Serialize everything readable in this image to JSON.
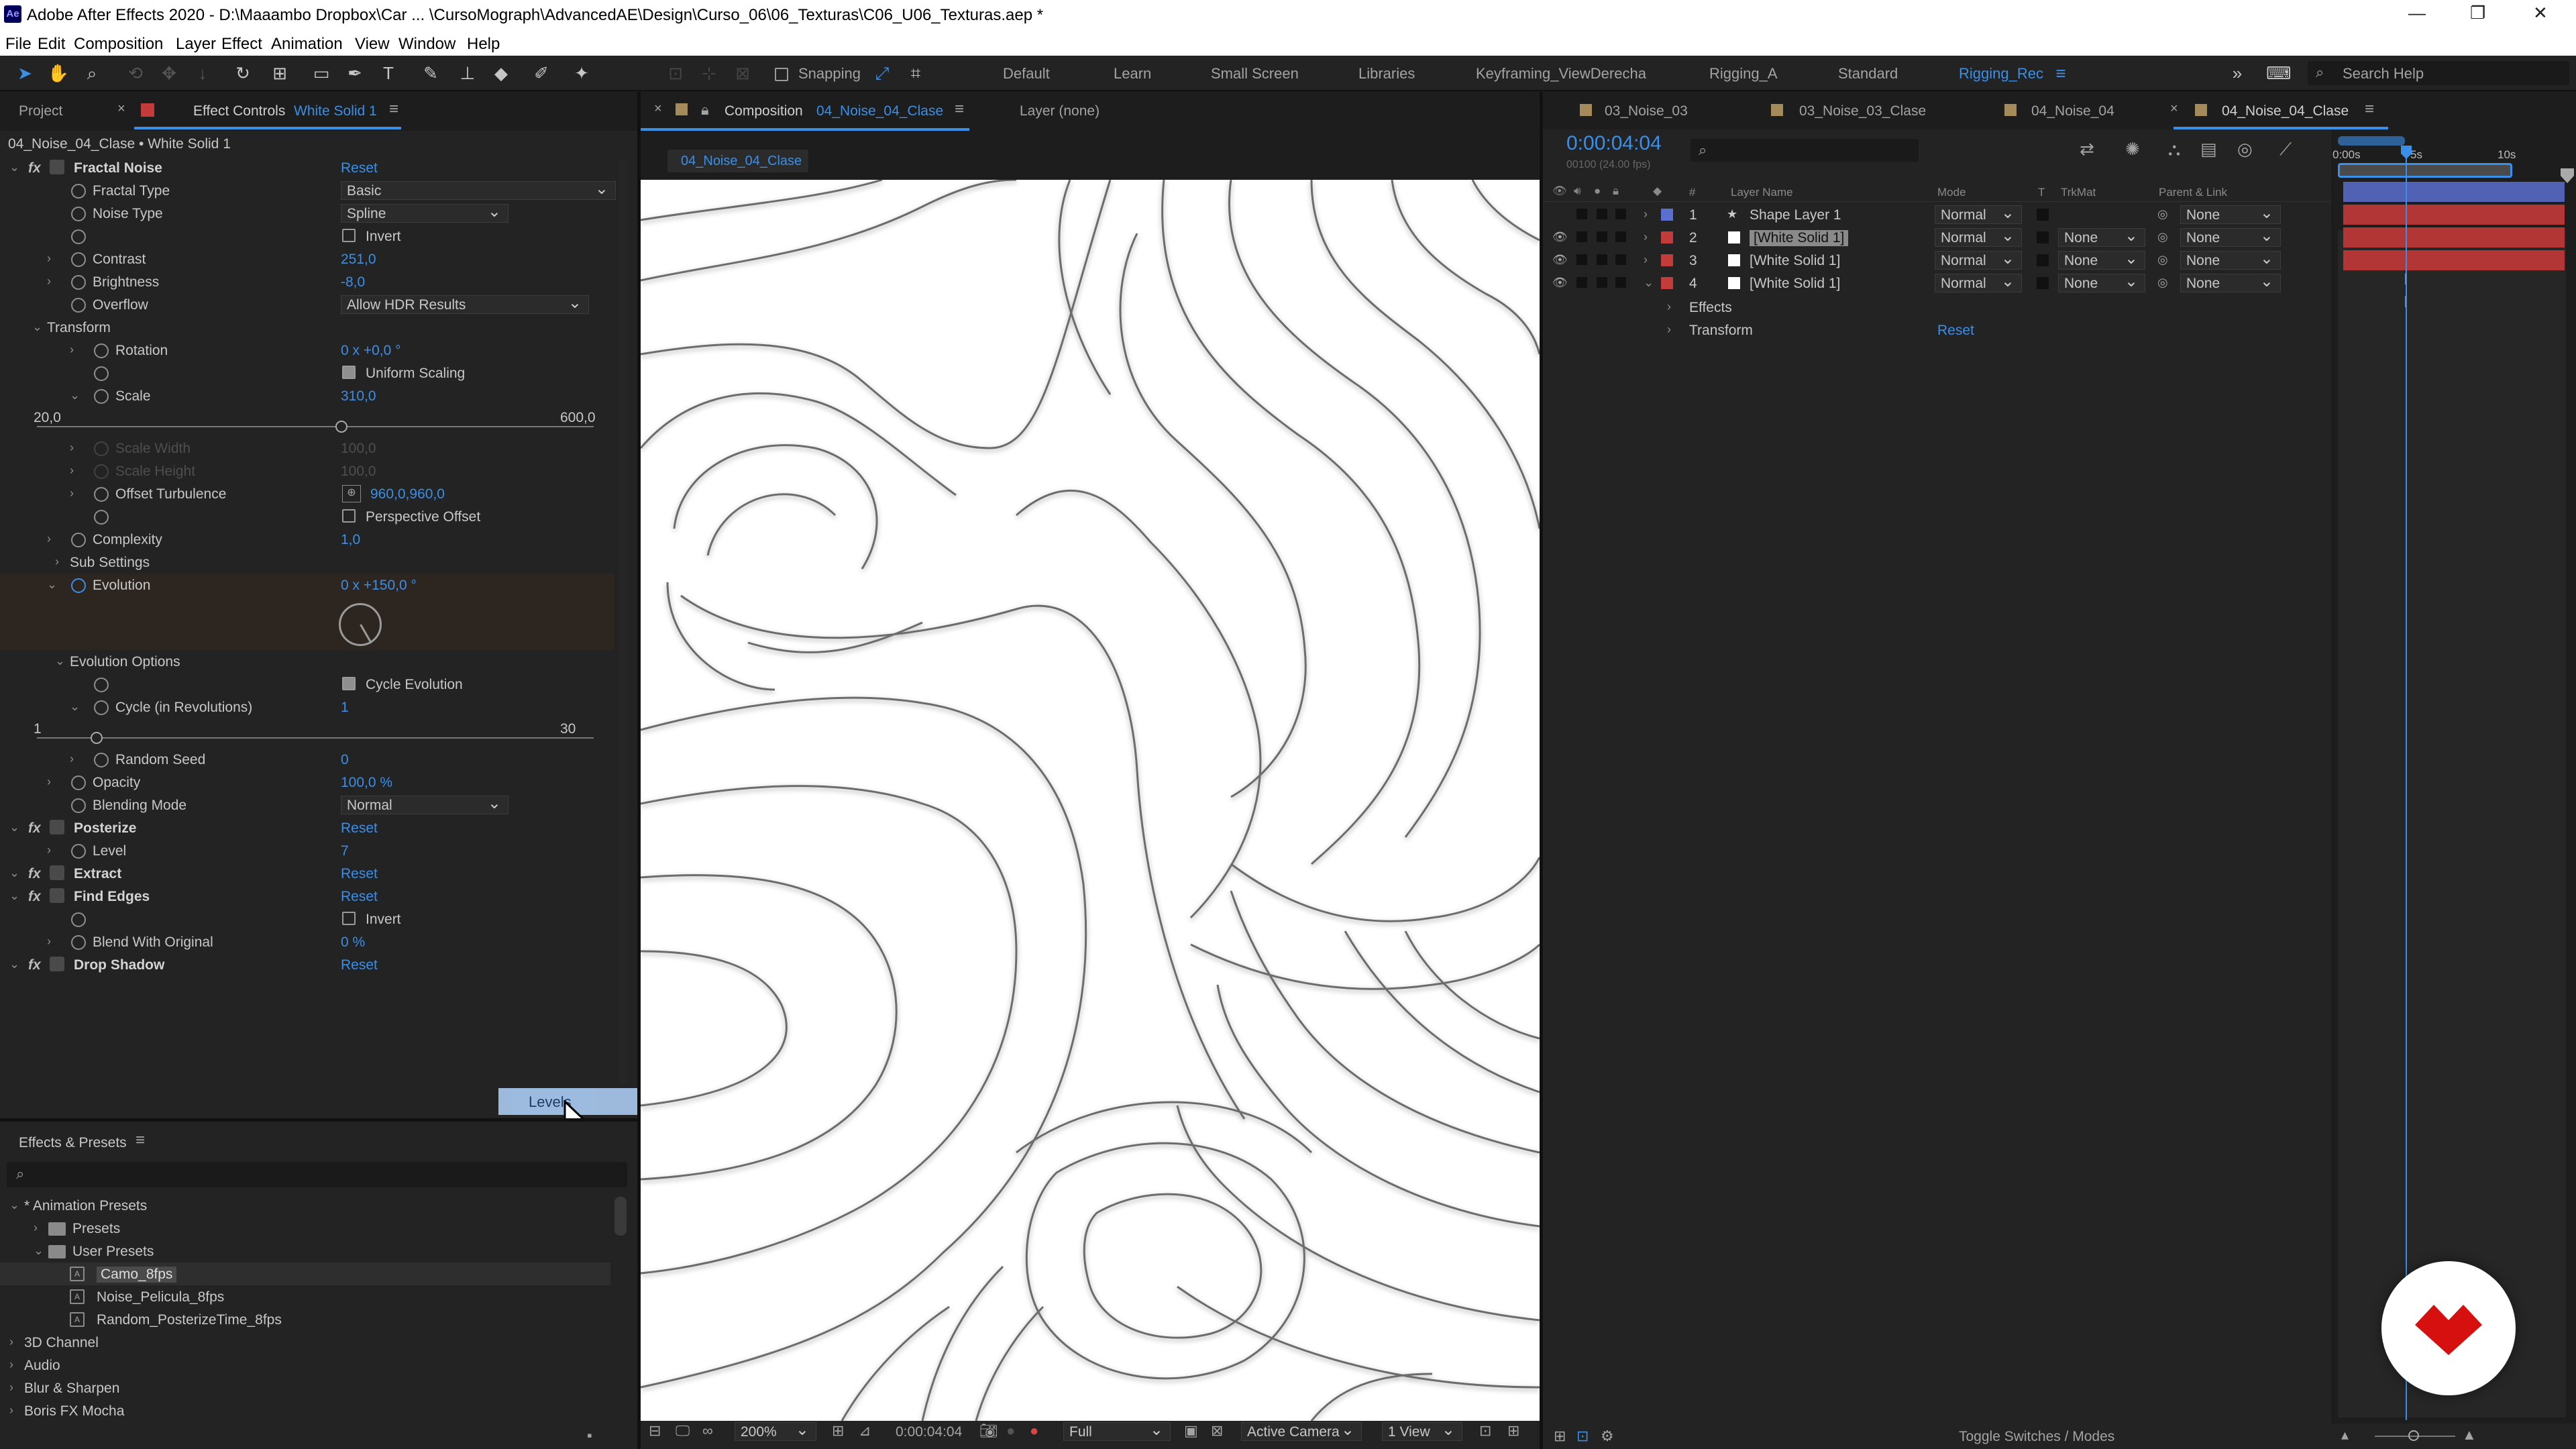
{
  "titlebar": {
    "app_icon": "Ae",
    "title": "Adobe After Effects 2020 - D:\\Maaambo Dropbox\\Car ... \\CursoMograph\\AdvancedAE\\Design\\Curso_06\\06_Texturas\\C06_U06_Texturas.aep *"
  },
  "menu": [
    "File",
    "Edit",
    "Composition",
    "Layer",
    "Effect",
    "Animation",
    "View",
    "Window",
    "Help"
  ],
  "toolbar": {
    "snapping": "Snapping",
    "workspaces": [
      "Default",
      "Learn",
      "Small Screen",
      "Libraries",
      "Keyframing_ViewDerecha",
      "Rigging_A",
      "Standard",
      "Rigging_Rec"
    ],
    "search_help": "Search Help"
  },
  "left_panel": {
    "tab_project": "Project",
    "tab_effect_controls": "Effect Controls",
    "tab_effect_target": "White Solid 1",
    "header": "04_Noise_04_Clase • White Solid 1",
    "rows": [
      {
        "label": "Fractal Noise",
        "value": "Reset",
        "kind": "fx"
      },
      {
        "label": "Fractal Type",
        "value": "Basic",
        "kind": "dropdown"
      },
      {
        "label": "Noise Type",
        "value": "Spline",
        "kind": "dropdown"
      },
      {
        "label": "",
        "value": "Invert",
        "kind": "check"
      },
      {
        "label": "Contrast",
        "value": "251,0",
        "kind": "value"
      },
      {
        "label": "Brightness",
        "value": "-8,0",
        "kind": "value"
      },
      {
        "label": "Overflow",
        "value": "Allow HDR Results",
        "kind": "dropdown"
      },
      {
        "label": "Transform",
        "value": "",
        "kind": "group"
      },
      {
        "label": "Rotation",
        "value": "0 x +0,0 °",
        "kind": "value"
      },
      {
        "label": "",
        "value": "Uniform Scaling",
        "kind": "checkon"
      },
      {
        "label": "Scale",
        "value": "310,0",
        "kind": "value"
      },
      {
        "label": "20,0",
        "value": "600,0",
        "kind": "slider"
      },
      {
        "label": "Scale Width",
        "value": "100,0",
        "kind": "disabled"
      },
      {
        "label": "Scale Height",
        "value": "100,0",
        "kind": "disabled"
      },
      {
        "label": "Offset Turbulence",
        "value": "960,0,960,0",
        "kind": "point"
      },
      {
        "label": "",
        "value": "Perspective Offset",
        "kind": "check"
      },
      {
        "label": "Complexity",
        "value": "1,0",
        "kind": "value"
      },
      {
        "label": "Sub Settings",
        "value": "",
        "kind": "group"
      },
      {
        "label": "Evolution",
        "value": "0 x +150,0 °",
        "kind": "evolution"
      },
      {
        "label": "",
        "value": "",
        "kind": "dial"
      },
      {
        "label": "Evolution Options",
        "value": "",
        "kind": "group"
      },
      {
        "label": "",
        "value": "Cycle Evolution",
        "kind": "checkon"
      },
      {
        "label": "Cycle (in Revolutions)",
        "value": "1",
        "kind": "value"
      },
      {
        "label": "1",
        "value": "30",
        "kind": "slider"
      },
      {
        "label": "Random Seed",
        "value": "0",
        "kind": "value"
      },
      {
        "label": "Opacity",
        "value": "100,0 %",
        "kind": "value"
      },
      {
        "label": "Blending Mode",
        "value": "Normal",
        "kind": "dropdown"
      },
      {
        "label": "Posterize",
        "value": "Reset",
        "kind": "fx"
      },
      {
        "label": "Level",
        "value": "7",
        "kind": "value"
      },
      {
        "label": "Extract",
        "value": "Reset",
        "kind": "fx"
      },
      {
        "label": "Find Edges",
        "value": "Reset",
        "kind": "fx"
      },
      {
        "label": "",
        "value": "Invert",
        "kind": "check"
      },
      {
        "label": "Blend With Original",
        "value": "0 %",
        "kind": "value"
      },
      {
        "label": "Drop Shadow",
        "value": "Reset",
        "kind": "fx"
      }
    ],
    "drag_label": "Levels"
  },
  "effects_presets": {
    "title": "Effects & Presets",
    "search_placeholder": "",
    "items": [
      "* Animation Presets",
      "Presets",
      "User Presets",
      "Camo_8fps",
      "Noise_Pelicula_8fps",
      "Random_PosterizeTime_8fps",
      "3D Channel",
      "Audio",
      "Blur & Sharpen",
      "Boris FX Mocha"
    ]
  },
  "comp_panel": {
    "tab_label": "Composition",
    "tab_comp": "04_Noise_04_Clase",
    "layer_tab": "Layer (none)",
    "breadcrumb": "04_Noise_04_Clase",
    "footer": {
      "zoom": "200%",
      "time": "0:00:04:04",
      "resolution": "Full",
      "camera": "Active Camera",
      "views": "1 View"
    }
  },
  "timeline": {
    "tabs": [
      "03_Noise_03",
      "03_Noise_03_Clase",
      "04_Noise_04",
      "04_Noise_04_Clase"
    ],
    "timecode": "0:00:04:04",
    "fps": "00100 (24.00 fps)",
    "columns": {
      "num": "#",
      "name": "Layer Name",
      "mode": "Mode",
      "t": "T",
      "trkmat": "TrkMat",
      "parent": "Parent & Link"
    },
    "layers": [
      {
        "num": "1",
        "name": "Shape Layer 1",
        "mode": "Normal",
        "trkmat": "",
        "parent": "None",
        "color": "#5a6fcf"
      },
      {
        "num": "2",
        "name": "[White Solid 1]",
        "mode": "Normal",
        "trkmat": "None",
        "parent": "None",
        "color": "#c33b3b"
      },
      {
        "num": "3",
        "name": "[White Solid 1]",
        "mode": "Normal",
        "trkmat": "None",
        "parent": "None",
        "color": "#c33b3b"
      },
      {
        "num": "4",
        "name": "[White Solid 1]",
        "mode": "Normal",
        "trkmat": "None",
        "parent": "None",
        "color": "#c33b3b"
      }
    ],
    "sub_effects": "Effects",
    "sub_transform": "Transform",
    "reset": "Reset",
    "ruler": [
      "0:00s",
      "5s",
      "10s"
    ],
    "footer": "Toggle Switches / Modes"
  },
  "colors": {
    "accent": "#3a8fe9",
    "panel": "#232323",
    "layer_red": "#b33636",
    "layer_blue": "#5a6fcf"
  }
}
